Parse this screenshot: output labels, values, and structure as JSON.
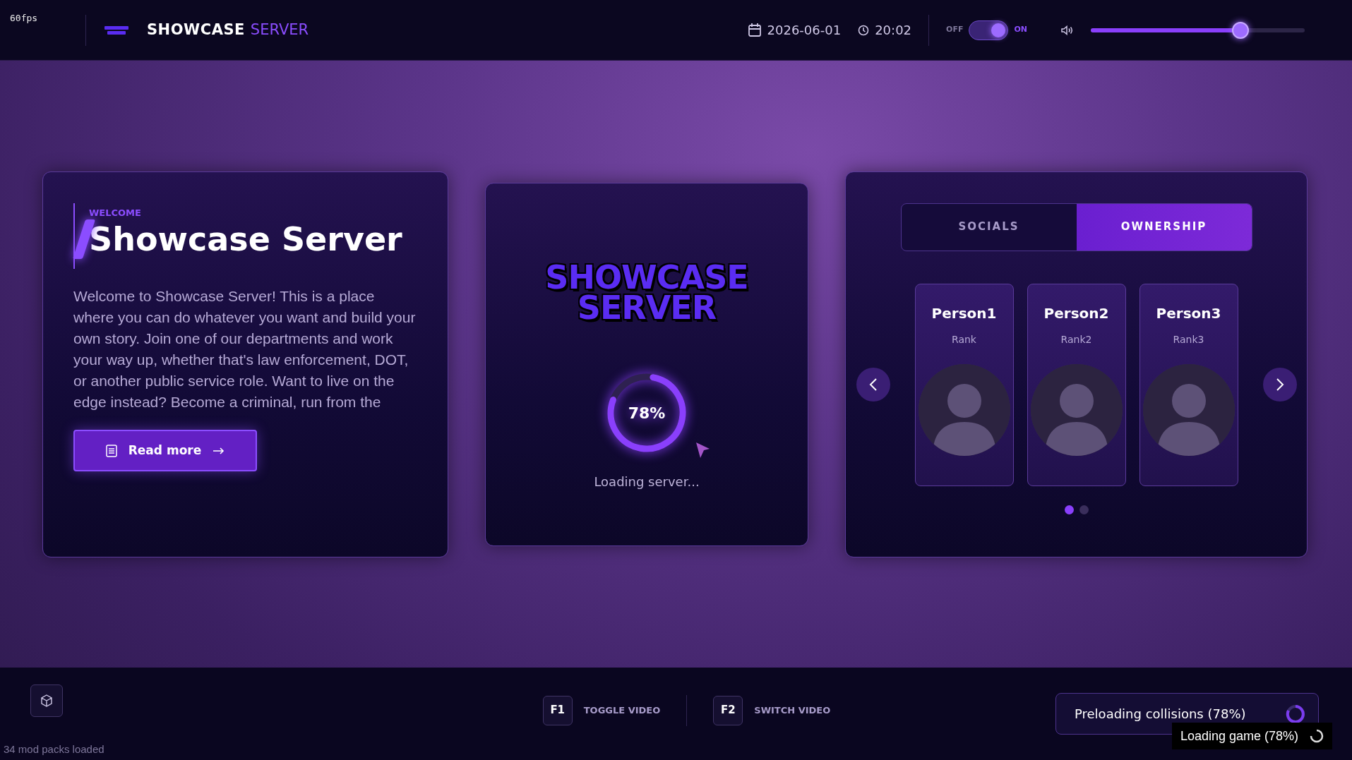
{
  "fps": "60fps",
  "header": {
    "title": "SHOWCASE",
    "title_accent": "SERVER",
    "date": "2026-06-01",
    "time": "20:02",
    "toggle": {
      "off_label": "OFF",
      "on_label": "ON",
      "on": true
    },
    "volume": {
      "level": 0.7
    }
  },
  "welcome": {
    "eyebrow": "WELCOME",
    "title": "Showcase Server",
    "text": "Welcome to Showcase Server! This is a place where you can do whatever you want and build your own story. Join one of our departments and work your way up, whether that's law enforcement, DOT, or another public service role. Want to live on the edge instead? Become a criminal, run from the",
    "button": "Read more"
  },
  "loader": {
    "logo_line_1": "SHOWCASE",
    "logo_line_2": "SERVER",
    "level": 0.78,
    "percent": "78%",
    "status": "Loading server..."
  },
  "team": {
    "tabs": [
      {
        "label": "SOCIALS",
        "selected": false
      },
      {
        "label": "OWNERSHIP",
        "selected": true
      }
    ],
    "people": [
      {
        "name": "Person1",
        "rank": "Rank"
      },
      {
        "name": "Person2",
        "rank": "Rank2"
      },
      {
        "name": "Person3",
        "rank": "Rank3"
      }
    ],
    "pages": [
      {
        "selected": true
      },
      {
        "selected": false
      }
    ]
  },
  "footer": {
    "mods": "34 mod packs loaded",
    "shortcuts": [
      {
        "key": "F1",
        "label": "TOGGLE VIDEO"
      },
      {
        "key": "F2",
        "label": "SWITCH VIDEO"
      }
    ],
    "preload": "Preloading collisions (78%)",
    "game_status": "Loading game (78%)"
  }
}
